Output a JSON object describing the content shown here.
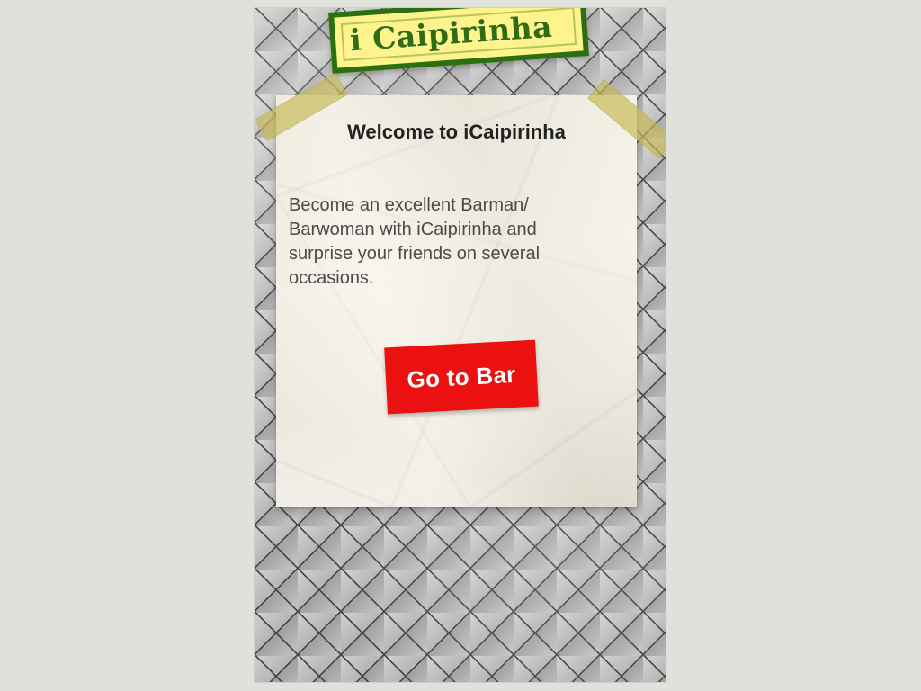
{
  "app": {
    "logo_text": "i Caipirinha"
  },
  "card": {
    "title": "Welcome to iCaipirinha",
    "description": "Become an excellent Barman/\nBarwoman with iCaipirinha and\nsurprise your friends on several\noccasions."
  },
  "actions": {
    "go_to_bar": "Go to Bar"
  },
  "colors": {
    "background": "#dfe1db",
    "logo_fill": "#fff38c",
    "logo_border": "#2b6f10",
    "logo_text": "#2f6c14",
    "paper": "#f4f0e3",
    "button": "#eb1111",
    "button_text": "#ffffff",
    "tape": "#c6b955"
  }
}
